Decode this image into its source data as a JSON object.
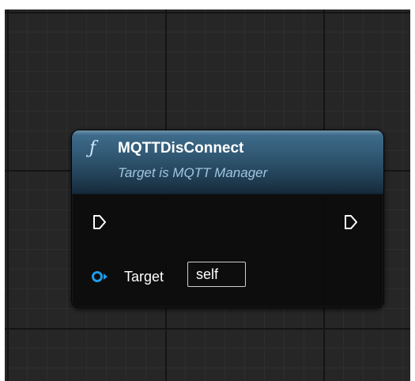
{
  "node": {
    "icon": "function-icon",
    "icon_glyph": "ƒ",
    "title": "MQTTDisConnect",
    "subtitle": "Target is MQTT Manager"
  },
  "pins": {
    "exec_in": "exec-input-pin-icon",
    "exec_out": "exec-output-pin-icon",
    "target": {
      "label": "Target",
      "value": "self",
      "pin_color": "#1e9bea"
    }
  },
  "colors": {
    "graph_background": "#262626",
    "header": "#335b77",
    "node_body": "#0c0c0c"
  }
}
